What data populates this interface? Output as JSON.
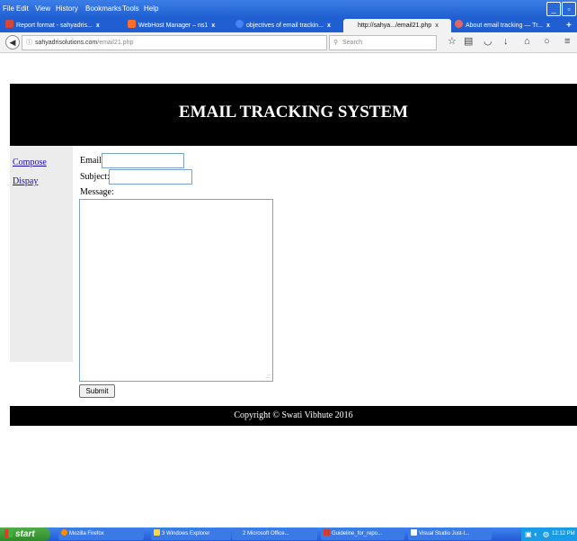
{
  "browser": {
    "menu": [
      "File",
      "Edit",
      "View",
      "History",
      "Bookmarks",
      "Tools",
      "Help"
    ],
    "tabs": [
      {
        "label": "Report format - sahyadris...",
        "close": "x",
        "icon_color": "#d44638"
      },
      {
        "label": "WebHost Manager – ns1",
        "close": "x",
        "icon_color": "#ff6c2c"
      },
      {
        "label": "objectives of email trackin...",
        "close": "x",
        "icon_color": "#4285f4"
      },
      {
        "label": "http://sahya.../email21.php",
        "close": "x",
        "icon_color": "#999999"
      },
      {
        "label": "About email tracking — Tr...",
        "close": "x",
        "icon_color": "#e06666"
      }
    ],
    "new_tab": "+",
    "url_host": "sahyadrisolutions.com",
    "url_path": "/email21.php",
    "search_placeholder": "Search"
  },
  "page": {
    "title": "EMAIL TRACKING SYSTEM",
    "nav": [
      "Compose",
      "Dispay"
    ],
    "form": {
      "email_label": "Email:",
      "email_value": "",
      "subject_label": "Subject:",
      "subject_value": "",
      "message_label": "Message:",
      "message_value": "",
      "submit_label": "Submit"
    },
    "footer": "Copyright © Swati Vibhute 2016"
  },
  "taskbar": {
    "start": "start",
    "items": [
      {
        "label": "Mozilla Firefox",
        "icon_color": "#ff8a00"
      },
      {
        "label": "3 Windows Explorer",
        "icon_color": "#ffd34d"
      },
      {
        "label": "2 Microsoft Office...",
        "icon_color": "#3f7ae0"
      },
      {
        "label": "Guideline_for_repo...",
        "icon_color": "#d8382a"
      },
      {
        "label": "Visual Studio Just-I...",
        "icon_color": "#ffffff"
      }
    ],
    "clock": "12:12 PM"
  },
  "colors": {
    "header_bg": "#000000",
    "sidebar_bg": "#ececec",
    "link": "#1a0dab",
    "titlebar": "#1f5fd1"
  }
}
